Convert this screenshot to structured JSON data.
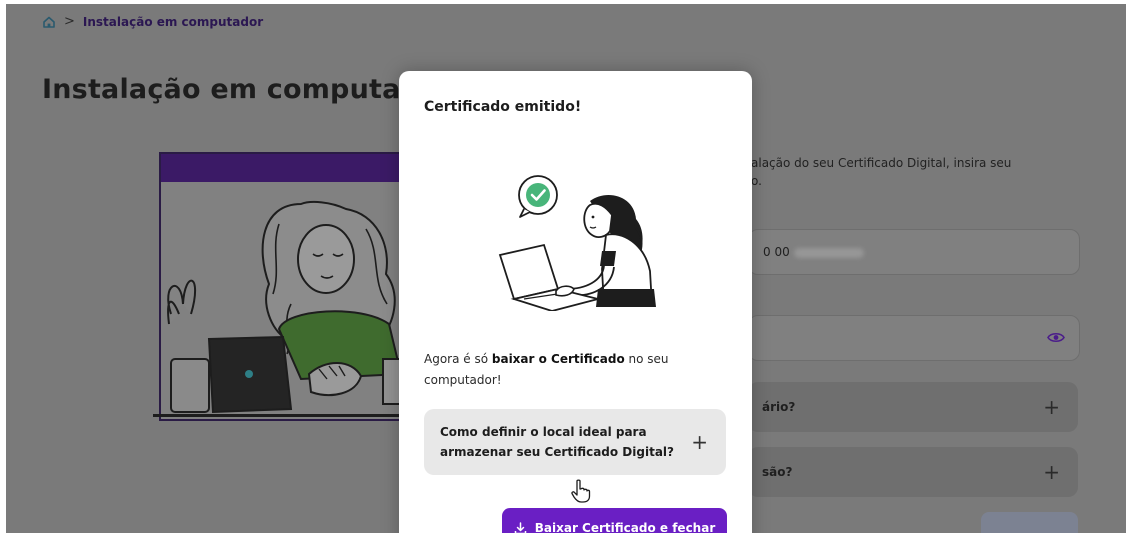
{
  "breadcrumb": {
    "icon": "home-icon",
    "separator": ">",
    "current": "Instalação em computador"
  },
  "page": {
    "title": "Instalação em computador"
  },
  "right_column": {
    "intro_line1": "alação do seu Certificado Digital, insira seu",
    "intro_line2": "o.",
    "field1_value": "0 00",
    "accordion1_label": "ário?",
    "accordion2_label": "são?",
    "plus_symbol": "+"
  },
  "modal": {
    "title": "Certificado emitido!",
    "message_prefix": "Agora é só ",
    "message_bold": "baixar o Certificado",
    "message_suffix": " no seu computador!",
    "faq_question": "Como definir o local ideal para armazenar seu Certificado Digital?",
    "faq_icon": "+",
    "button_label": "Baixar Certificado e fechar",
    "button_icon": "download-icon"
  },
  "colors": {
    "primary": "#6a1fc4",
    "check_green": "#48b57a",
    "overlay": "#7a7a7a",
    "accent_dark": "#3b1a66"
  }
}
